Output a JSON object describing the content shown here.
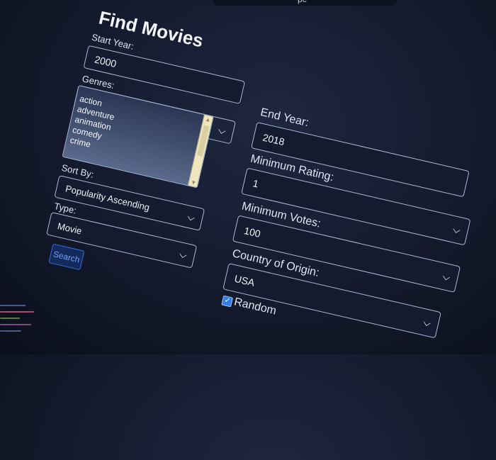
{
  "form": {
    "title": "Find Movies",
    "start_year": {
      "label": "Start Year:",
      "value": "2000"
    },
    "end_year": {
      "label": "End Year:",
      "value": "2018"
    },
    "genres": {
      "label": "Genres:",
      "options": [
        "action",
        "adventure",
        "animation",
        "comedy",
        "crime"
      ]
    },
    "minimum_rating": {
      "label": "Minimum Rating:",
      "value": "1"
    },
    "minimum_votes": {
      "label": "Minimum Votes:",
      "value": "100"
    },
    "sort_by": {
      "label": "Sort By:",
      "value": "Popularity Ascending"
    },
    "country": {
      "label": "Country of Origin:",
      "value": "USA"
    },
    "type": {
      "label": "Type:",
      "value": "Movie"
    },
    "random": {
      "label": "Random",
      "checked": true
    },
    "search_label": "Search"
  },
  "icons": {
    "chevron": "chevron-down-icon",
    "check": "checkmark-icon"
  },
  "colors": {
    "background": "#141a2c",
    "field_border": "#aab7d4",
    "accent": "#2f7de8"
  }
}
